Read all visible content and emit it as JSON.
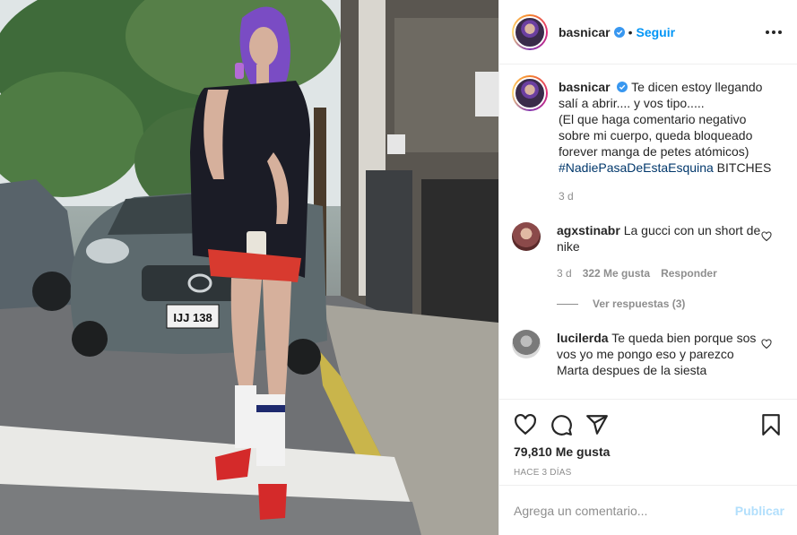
{
  "header": {
    "username": "basnicar",
    "separator": "•",
    "follow_label": "Seguir"
  },
  "caption": {
    "username": "basnicar",
    "text_line1": "Te dicen estoy llegando salí a abrir.... y vos tipo.....",
    "text_line2": "(El que haga comentario negativo sobre mi cuerpo, queda bloqueado forever manga de petes atómicos)",
    "hashtag": "#NadiePasaDeEstaEsquina",
    "text_tail": " BITCHES",
    "time": "3 d"
  },
  "comments": [
    {
      "username": "agxstinabr",
      "text": "La gucci con un short de nike",
      "time": "3 d",
      "likes": "322 Me gusta",
      "reply_label": "Responder",
      "view_replies": "Ver respuestas (3)"
    },
    {
      "username": "lucilerda",
      "text": "Te queda bien porque sos vos yo me pongo eso y parezco Marta despues de la siesta"
    }
  ],
  "actions": {
    "likes": "79,810 Me gusta",
    "posted_ago": "HACE 3 DÍAS",
    "icons": [
      "heart-icon",
      "comment-icon",
      "share-icon",
      "bookmark-icon"
    ]
  },
  "add_comment": {
    "placeholder": "Agrega un comentario...",
    "publish_label": "Publicar"
  },
  "photo": {
    "license_plate": "IJJ 138"
  },
  "colors": {
    "link_blue": "#0095f6",
    "publish_disabled": "#b2dffc",
    "hashtag": "#00376b",
    "muted": "#8e8e8e"
  }
}
